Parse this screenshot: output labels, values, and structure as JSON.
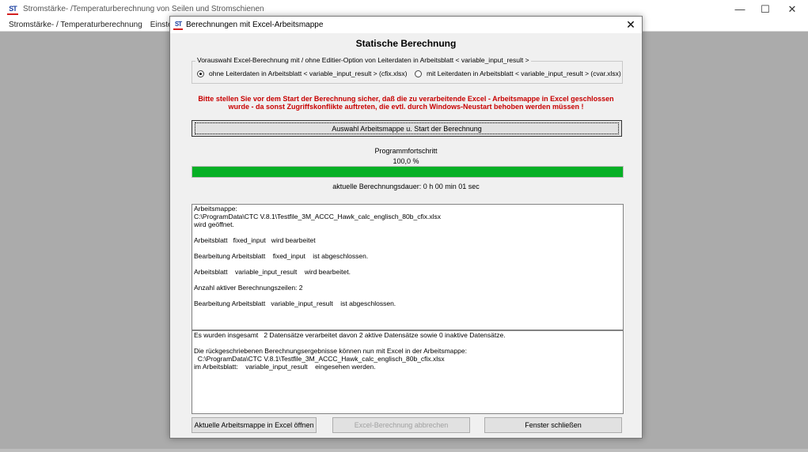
{
  "main_window": {
    "title": "Stromstärke- /Temperaturberechnung von Seilen und Stromschienen",
    "app_icon_text": "ST",
    "controls": {
      "minimize": "—",
      "maximize": "☐",
      "close": "✕"
    },
    "menu": [
      "Stromstärke- / Temperaturberechnung",
      "Einstellun"
    ]
  },
  "dialog": {
    "title": "Berechnungen mit Excel-Arbeitsmappe",
    "close_glyph": "✕",
    "heading": "Statische Berechnung",
    "group_legend": "Vorauswahl Excel-Berechnung mit / ohne Editier-Option von Leiterdaten in Arbeitsblatt < variable_input_result >",
    "radio_options": [
      {
        "label": "ohne Leiterdaten in Arbeitsblatt < variable_input_result > (cfix.xlsx)",
        "checked": true
      },
      {
        "label": "mit Leiterdaten in Arbeitsblatt < variable_input_result > (cvar.xlsx)",
        "checked": false
      }
    ],
    "warning_lines": [
      "Bitte stellen Sie vor dem Start der Berechnung sicher, daß die zu verarbeitende Excel - Arbeitsmappe in Excel geschlossen",
      "wurde - da sonst Zugriffskonflikte auftreten, die evtl. durch Windows-Neustart behoben werden müssen !"
    ],
    "warning_color": "#c80000",
    "start_button": "Auswahl Arbeitsmappe u. Start der Berechnung",
    "progress_label": "Programmfortschritt",
    "progress_percent_text": "100,0 %",
    "progress_fraction": 1.0,
    "progress_color": "#06b025",
    "duration_text": "aktuelle Berechnungsdauer: 0 h 00 min 01 sec",
    "log1": [
      "Arbeitsmappe:",
      "C:\\ProgramData\\CTC V.8.1\\Testfile_3M_ACCC_Hawk_calc_englisch_80b_cfix.xlsx",
      "wird geöffnet.",
      "",
      "Arbeitsblatt   fixed_input   wird bearbeitet",
      "",
      "Bearbeitung Arbeitsblatt    fixed_input    ist abgeschlossen.",
      "",
      "Arbeitsblatt    variable_input_result    wird bearbeitet.",
      "",
      "Anzahl aktiver Berechnungszeilen: 2",
      "",
      "Bearbeitung Arbeitsblatt   variable_input_result    ist abgeschlossen."
    ],
    "log2": [
      "Es wurden insgesamt   2 Datensätze verarbeitet davon 2 aktive Datensätze sowie 0 inaktive Datensätze.",
      "",
      "Die rückgeschriebenen Berechnungsergebnisse können nun mit Excel in der Arbeitsmappe:",
      "  C:\\ProgramData\\CTC V.8.1\\Testfile_3M_ACCC_Hawk_calc_englisch_80b_cfix.xlsx",
      "im Arbeitsblatt:    variable_input_result    eingesehen werden."
    ],
    "buttons": {
      "open_excel": "Aktuelle Arbeitsmappe in Excel öffnen",
      "abort": "Excel-Berechnung abbrechen",
      "close_window": "Fenster schließen"
    }
  }
}
